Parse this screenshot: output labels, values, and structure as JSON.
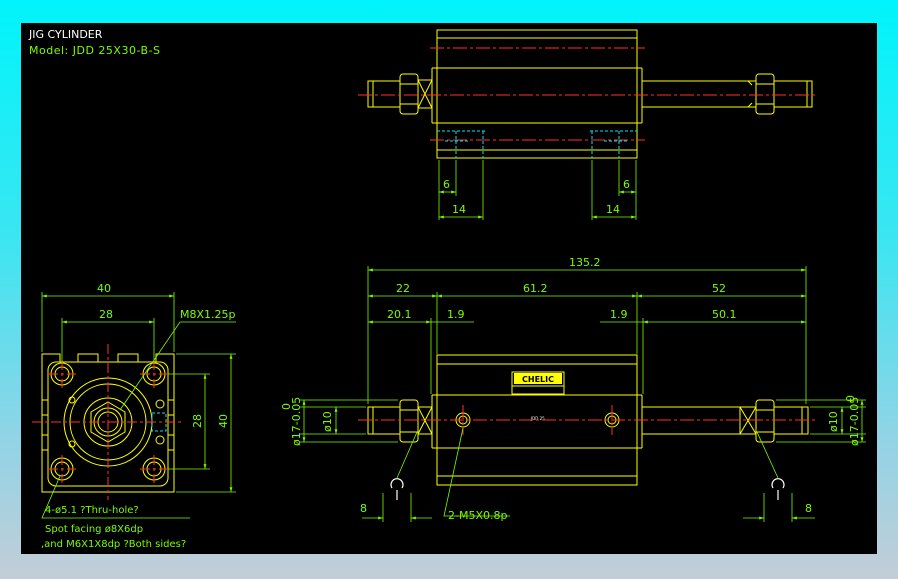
{
  "title": "JIG CYLINDER",
  "model": "Model:  JDD 25X30-B-S",
  "top_view": {
    "dim_left_small": "6",
    "dim_right_small": "6",
    "dim_left_wide": "14",
    "dim_right_wide": "14"
  },
  "end_view": {
    "width_overall": "40",
    "width_inner": "28",
    "thread": "M8X1.25p",
    "height_inner": "28",
    "height_overall": "40",
    "holes_note": "4-ø5.1 ?Thru-hole?",
    "spot_note": "Spot facing  ø8X6dp",
    "tap_note": ",and M6X1X8dp ?Both sides?"
  },
  "side_view": {
    "overall": "135.2",
    "left_len": "22",
    "body_len": "61.2",
    "right_len": "52",
    "left_rod": "20.1",
    "left_gap": "1.9",
    "right_gap": "1.9",
    "right_rod": "50.1",
    "dia_left_a": "ø17-0.05",
    "dia_left_a_upper": "0",
    "dia_left_b": "ø10",
    "dia_right_a": "ø10",
    "dia_right_b": "ø17-0.05",
    "dia_right_b_upper": "0",
    "port_note": "2-M5X0.8p",
    "wrench_left": "8",
    "wrench_right": "8",
    "label_brand": "CHELIC",
    "label_small": "JDD 25"
  },
  "colors": {
    "outline": "#ffff00",
    "dimension": "#7cfc00",
    "centerline": "#ff3030",
    "hidden": "#00e5ff",
    "title": "#ffffff"
  }
}
